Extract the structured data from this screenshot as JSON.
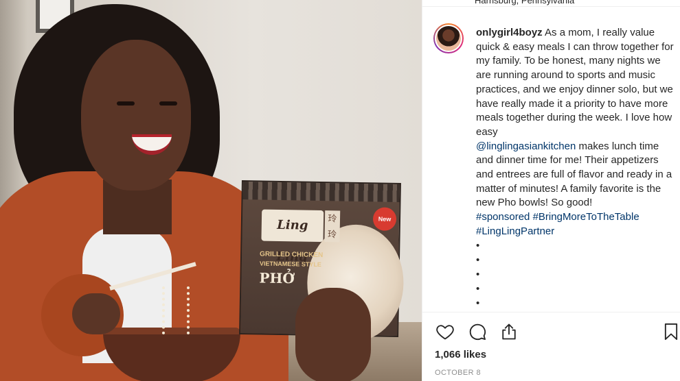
{
  "post": {
    "location": "Harrisburg, Pennsylvania",
    "username": "onlygirl4boyz",
    "caption_part1": "As a mom, I really value quick & easy meals I can throw together for my family. To be honest, many nights we are running around to sports and music practices, and we enjoy dinner solo, but we have really made it a priority to have more meals together during the week. I love how easy",
    "mention": "@linglingasiankitchen",
    "caption_part2": "makes lunch time and dinner time for me! Their appetizers and entrees are full of flavor and ready in a matter of minutes! A family favorite is the new Pho bowls! So good!",
    "hashtags": [
      "#sponsored",
      "#BringMoreToTheTable",
      "#LingLingPartner"
    ],
    "dots": [
      "•",
      "•",
      "•",
      "•",
      "•"
    ],
    "likes": "1,066 likes",
    "date": "OCTOBER 8"
  },
  "photo": {
    "box_brand": "Ling Ling",
    "box_kanji": "玲玲",
    "box_badge": "New",
    "box_line1": "GRILLED CHICKEN",
    "box_line2": "VIETNAMESE STYLE",
    "box_line3": "PHỞ"
  },
  "icons": {
    "like": "heart-icon",
    "comment": "comment-icon",
    "share": "share-icon",
    "save": "bookmark-icon"
  },
  "colors": {
    "link": "#003569",
    "text": "#262626",
    "muted": "#8e8e8e",
    "border": "#efefef"
  }
}
